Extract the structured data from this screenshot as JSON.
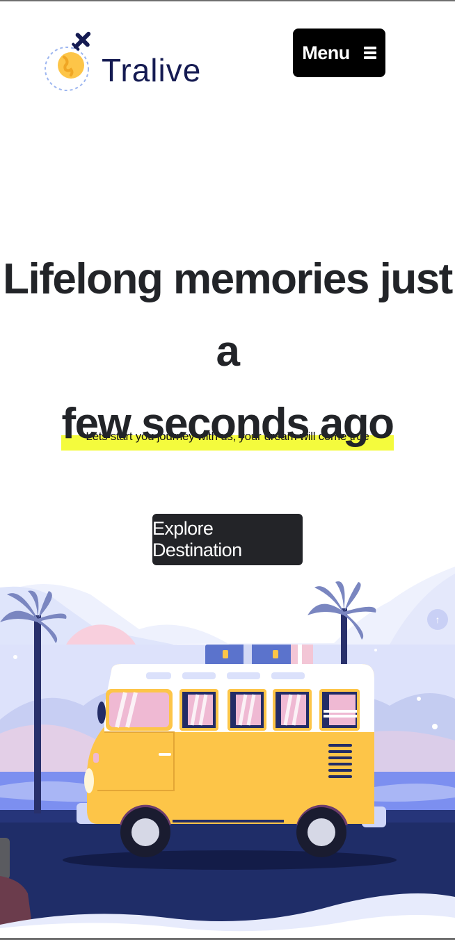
{
  "header": {
    "brand_name": "Tralive",
    "menu_label": "Menu",
    "menu_icon": "hamburger-icon",
    "logo_icon": "globe-airplane-logo"
  },
  "hero": {
    "headline_line1": "Lifelong memories just a",
    "headline_line2": "few seconds ago",
    "subtitle": "Lets start you journey with us, your dream will come true",
    "cta_label": "Explore Destination"
  },
  "illustration": {
    "subject": "yellow-van-beach-illustration"
  },
  "colors": {
    "text_dark": "#222428",
    "brand_navy": "#151b52",
    "highlight_yellow": "#f4fb3d",
    "van_yellow": "#fdc548",
    "button_dark": "#232428"
  }
}
